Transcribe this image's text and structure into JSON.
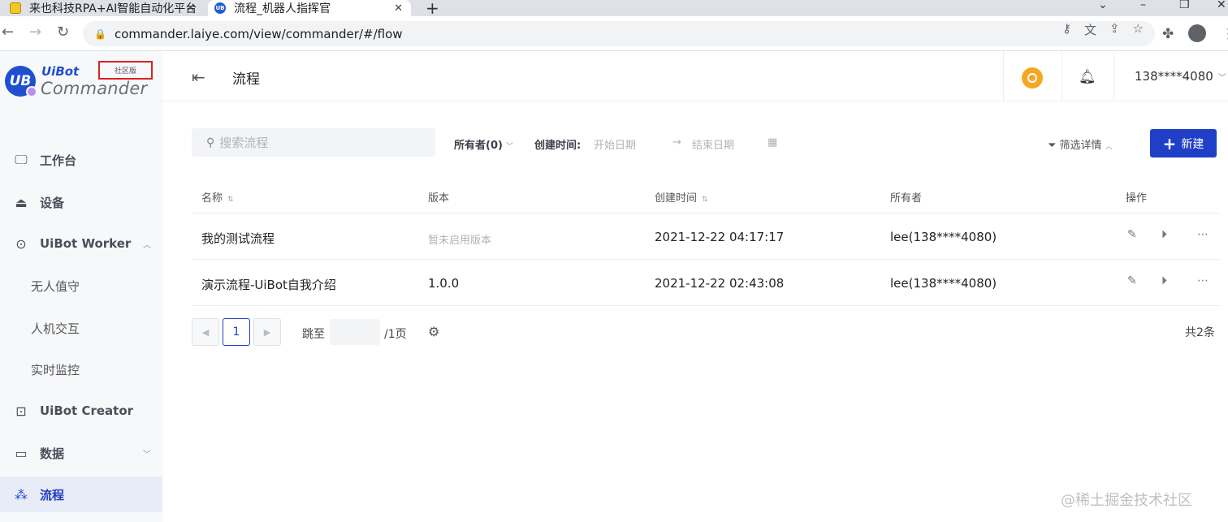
{
  "browser": {
    "tabs": [
      {
        "title": "来也科技RPA+AI智能自动化平台"
      },
      {
        "title": "流程_机器人指挥官"
      }
    ],
    "new_tab_icon": "plus-icon",
    "url": "commander.laiye.com/view/commander/#/flow"
  },
  "logo": {
    "brand": "UiBot",
    "product": "Commander",
    "badge_text": "UB",
    "edition": "社区版"
  },
  "sidebar": {
    "items": [
      {
        "label": "工作台",
        "icon": "monitor-icon"
      },
      {
        "label": "设备",
        "icon": "device-icon"
      },
      {
        "label": "UiBot Worker",
        "icon": "robot-icon"
      },
      {
        "label": "无人值守"
      },
      {
        "label": "人机交互"
      },
      {
        "label": "实时监控"
      },
      {
        "label": "UiBot Creator",
        "icon": "terminal-icon"
      },
      {
        "label": "数据",
        "icon": "folder-icon"
      },
      {
        "label": "流程",
        "icon": "flow-icon"
      }
    ]
  },
  "header": {
    "title": "流程",
    "user": "138****4080"
  },
  "filters": {
    "search_placeholder": "搜索流程",
    "owner": "所有者(0)",
    "created_label": "创建时间:",
    "start_placeholder": "开始日期",
    "end_placeholder": "结束日期",
    "filter_details": "筛选详情",
    "new_button": "新建"
  },
  "table": {
    "columns": [
      "名称",
      "版本",
      "创建时间",
      "所有者",
      "操作"
    ],
    "rows": [
      {
        "name": "我的测试流程",
        "version": "暂未启用版本",
        "created": "2021-12-22 04:17:17",
        "owner": "lee(138****4080)"
      },
      {
        "name": "演示流程-UiBot自我介绍",
        "version": "1.0.0",
        "created": "2021-12-22 02:43:08",
        "owner": "lee(138****4080)"
      }
    ]
  },
  "pagination": {
    "current_page": "1",
    "jump_label": "跳至",
    "page_suffix": "/1页",
    "total": "共2条"
  },
  "watermark": "@稀土掘金技术社区",
  "colors": {
    "primary": "#1f3fc7",
    "active_bg": "#e8ecf6",
    "sidebar_bg": "#f7f8fa",
    "bulb": "#f5a623",
    "edition_border": "#e02020"
  }
}
